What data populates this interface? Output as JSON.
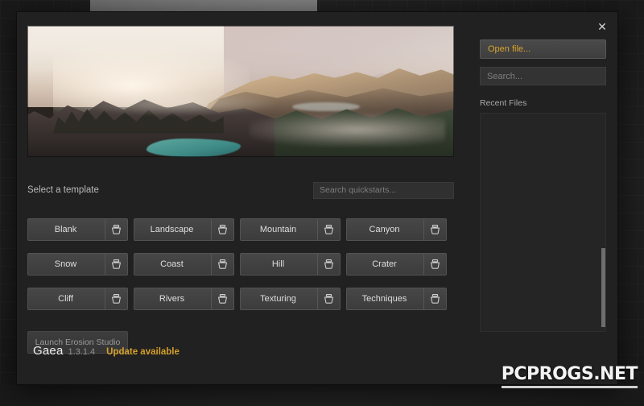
{
  "app": {
    "brand_name": "Gaea",
    "version": "1.3.1.4",
    "update_text": "Update available",
    "accent_color": "#d5a02a",
    "dialog_bg": "#212121"
  },
  "dialog": {
    "close_icon": "close-icon",
    "close_label": "✕"
  },
  "hero": {
    "alt": "Sunlit misty mountain ridge with pine forest and a teal lake"
  },
  "templates": {
    "section_label": "Select a template",
    "search": {
      "placeholder": "Search quickstarts...",
      "value": ""
    },
    "icon_name": "bucket-icon",
    "items": [
      {
        "label": "Blank"
      },
      {
        "label": "Landscape"
      },
      {
        "label": "Mountain"
      },
      {
        "label": "Canyon"
      },
      {
        "label": "Snow"
      },
      {
        "label": "Coast"
      },
      {
        "label": "Hill"
      },
      {
        "label": "Crater"
      },
      {
        "label": "Cliff"
      },
      {
        "label": "Rivers"
      },
      {
        "label": "Texturing"
      },
      {
        "label": "Techniques"
      }
    ]
  },
  "actions": {
    "launch_erosion_studio": "Launch Erosion Studio"
  },
  "sidebar": {
    "open_file_label": "Open file...",
    "file_search": {
      "placeholder": "Search...",
      "value": ""
    },
    "recent_files_label": "Recent Files",
    "recent_files": []
  },
  "watermark": {
    "text": "PCPROGS.NET"
  }
}
